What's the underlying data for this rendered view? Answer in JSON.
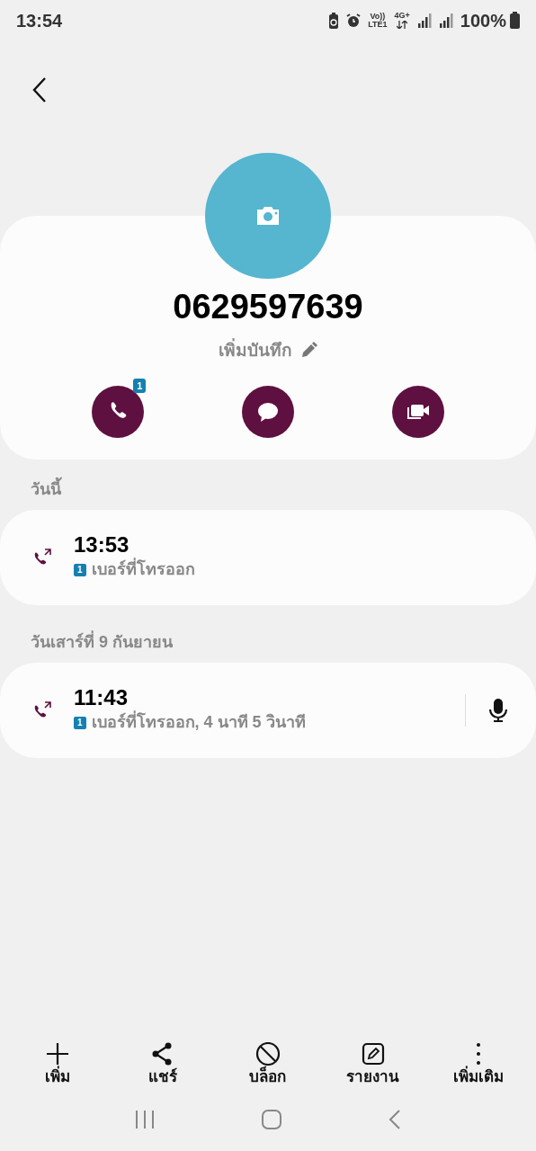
{
  "status_bar": {
    "time": "13:54",
    "volte_top": "Vo))",
    "volte_bottom": "LTE1",
    "network": "4G+",
    "battery": "100%"
  },
  "contact": {
    "number": "0629597639",
    "note": "เพิ่มบันทึก"
  },
  "actions": [
    {
      "kind": "call",
      "badge": "1"
    },
    {
      "kind": "message"
    },
    {
      "kind": "video"
    }
  ],
  "history": [
    {
      "date": "วันนี้",
      "calls": [
        {
          "time": "13:53",
          "sim": "1",
          "detail": "เบอร์ที่โทรออก",
          "recording": false
        }
      ]
    },
    {
      "date": "วันเสาร์ที่ 9 กันยายน",
      "calls": [
        {
          "time": "11:43",
          "sim": "1",
          "detail": "เบอร์ที่โทรออก, 4 นาที 5 วินาที",
          "recording": true
        }
      ]
    }
  ],
  "toolbar": [
    {
      "kind": "add",
      "label": "เพิ่ม"
    },
    {
      "kind": "share",
      "label": "แชร์"
    },
    {
      "kind": "block",
      "label": "บล็อก"
    },
    {
      "kind": "report",
      "label": "รายงาน"
    },
    {
      "kind": "more",
      "label": "เพิ่มเติม"
    }
  ]
}
